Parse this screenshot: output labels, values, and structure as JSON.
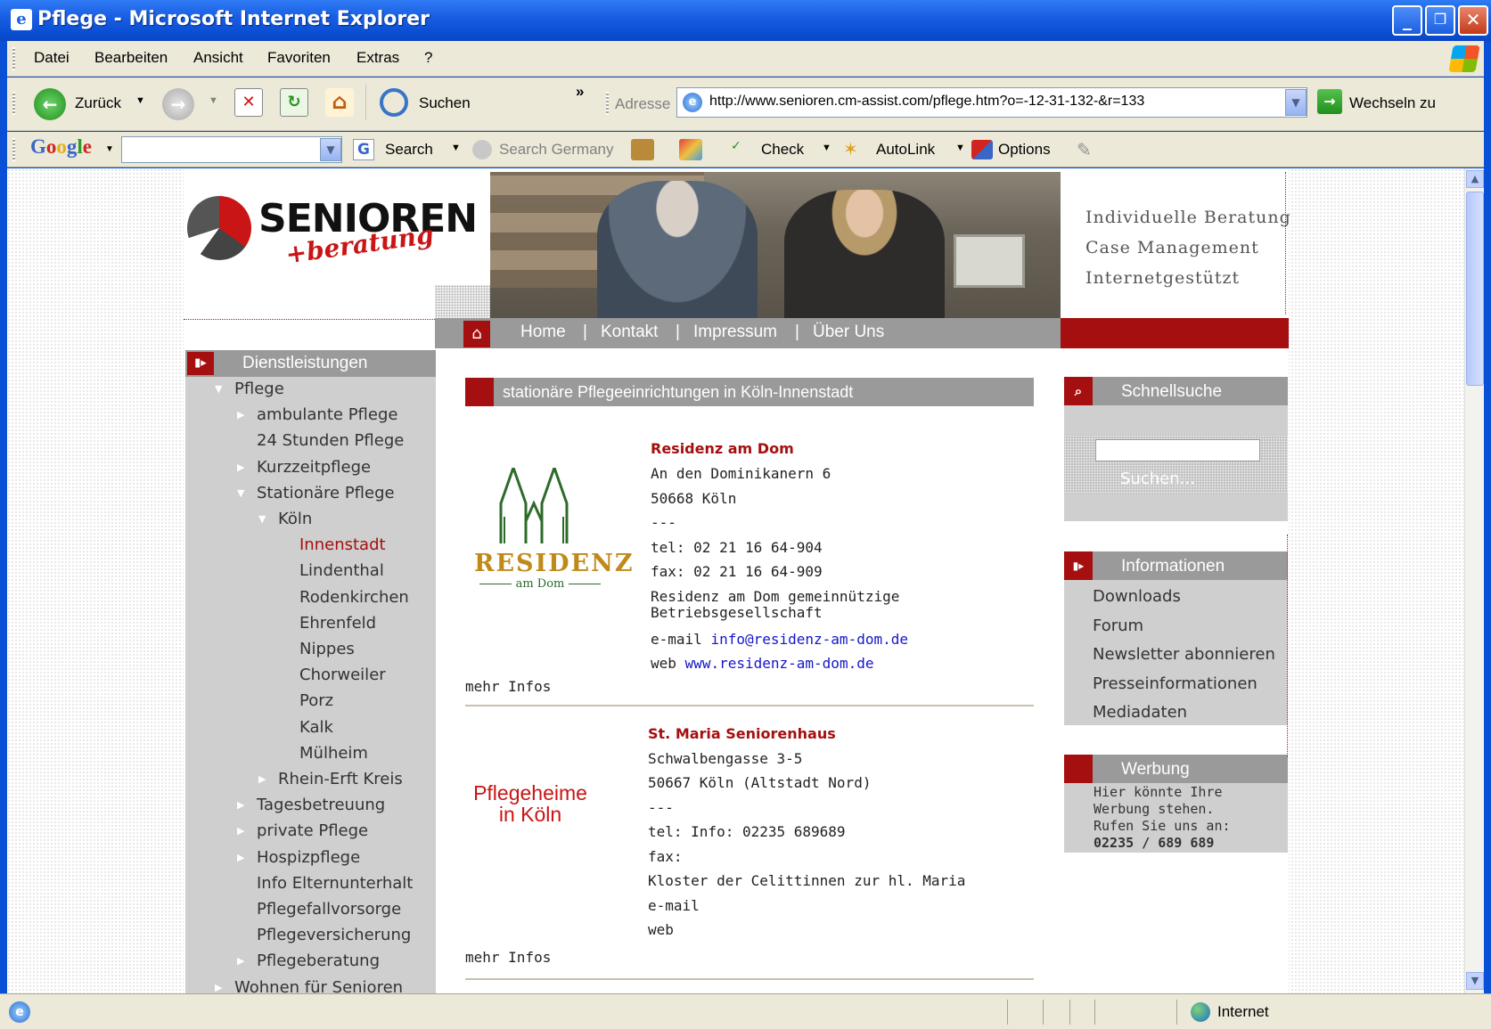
{
  "window": {
    "title": "Pflege - Microsoft Internet Explorer"
  },
  "menu": [
    "Datei",
    "Bearbeiten",
    "Ansicht",
    "Favoriten",
    "Extras",
    "?"
  ],
  "toolbar": {
    "back": "Zurück",
    "search": "Suchen",
    "chevron": "»",
    "address_label": "Adresse",
    "url": "http://www.senioren.cm-assist.com/pflege.htm?o=-12-31-132-&r=133",
    "go": "Wechseln zu"
  },
  "googlebar": {
    "logo": "Google",
    "search": "Search",
    "search_germany": "Search Germany",
    "check": "Check",
    "autolink": "AutoLink",
    "options": "Options"
  },
  "site": {
    "logo_main": "SENIOREN",
    "logo_sub": "+beratung",
    "taglines": [
      "Individuelle Beratung",
      "Case Management",
      "Internetgestützt"
    ],
    "nav": [
      "Home",
      "Kontakt",
      "Impressum",
      "Über Uns"
    ],
    "nav_sep": "|",
    "sidebar_heading": "Dienstleistungen",
    "sidebar": [
      {
        "label": "Pflege",
        "indent": 0,
        "marker": "down"
      },
      {
        "label": "ambulante Pflege",
        "indent": 1,
        "marker": "right"
      },
      {
        "label": "24 Stunden Pflege",
        "indent": 1,
        "marker": ""
      },
      {
        "label": "Kurzzeitpflege",
        "indent": 1,
        "marker": "right"
      },
      {
        "label": "Stationäre Pflege",
        "indent": 1,
        "marker": "down"
      },
      {
        "label": "Köln",
        "indent": 2,
        "marker": "down"
      },
      {
        "label": "Innenstadt",
        "indent": 3,
        "marker": "",
        "active": true
      },
      {
        "label": "Lindenthal",
        "indent": 3,
        "marker": ""
      },
      {
        "label": "Rodenkirchen",
        "indent": 3,
        "marker": ""
      },
      {
        "label": "Ehrenfeld",
        "indent": 3,
        "marker": ""
      },
      {
        "label": "Nippes",
        "indent": 3,
        "marker": ""
      },
      {
        "label": "Chorweiler",
        "indent": 3,
        "marker": ""
      },
      {
        "label": "Porz",
        "indent": 3,
        "marker": ""
      },
      {
        "label": "Kalk",
        "indent": 3,
        "marker": ""
      },
      {
        "label": "Mülheim",
        "indent": 3,
        "marker": ""
      },
      {
        "label": "Rhein-Erft Kreis",
        "indent": 2,
        "marker": "right"
      },
      {
        "label": "Tagesbetreuung",
        "indent": 1,
        "marker": "right"
      },
      {
        "label": "private Pflege",
        "indent": 1,
        "marker": "right"
      },
      {
        "label": "Hospizpflege",
        "indent": 1,
        "marker": "right"
      },
      {
        "label": "Info Elternunterhalt",
        "indent": 1,
        "marker": ""
      },
      {
        "label": "Pflegefallvorsorge",
        "indent": 1,
        "marker": ""
      },
      {
        "label": "Pflegeversicherung",
        "indent": 1,
        "marker": ""
      },
      {
        "label": "Pflegeberatung",
        "indent": 1,
        "marker": "right"
      },
      {
        "label": "Wohnen für Senioren",
        "indent": 0,
        "marker": "right"
      }
    ],
    "content_heading": "stationäre Pflegeeinrichtungen in Köln-Innenstadt",
    "entries": [
      {
        "name": "Residenz am Dom",
        "street": "An den Dominikanern 6",
        "city": "50668 Köln",
        "dash": "---",
        "tel": "tel: 02 21 16 64-904",
        "fax": "fax: 02 21 16 64-909",
        "operator": "Residenz am Dom gemeinnützige Betriebsgesellschaft",
        "email_label": "e-mail",
        "email": "info@residenz-am-dom.de",
        "web_label": "web",
        "web": "www.residenz-am-dom.de",
        "more": "mehr Infos",
        "logo_word": "RESIDENZ",
        "logo_sub": "am Dom"
      },
      {
        "name": "St. Maria Seniorenhaus",
        "street": "Schwalbengasse 3-5",
        "city": "50667 Köln (Altstadt Nord)",
        "dash": "---",
        "tel": "tel: Info: 02235 689689",
        "fax": "fax:",
        "operator": "Kloster der Celittinnen zur hl. Maria",
        "email_label": "e-mail",
        "web_label": "web",
        "more": "mehr Infos",
        "logo_line1": "Pflegeheime",
        "logo_line2": "in Köln"
      }
    ],
    "quicksearch": {
      "heading": "Schnellsuche",
      "button": "Suchen..."
    },
    "info": {
      "heading": "Informationen",
      "links": [
        "Downloads",
        "Forum",
        "Newsletter abonnieren",
        "Presseinformationen",
        "Mediadaten"
      ]
    },
    "ad": {
      "heading": "Werbung",
      "lines": [
        "Hier könnte Ihre",
        "Werbung stehen.",
        "Rufen Sie uns an:"
      ],
      "phone": "02235 / 689 689"
    }
  },
  "status": {
    "zone": "Internet"
  }
}
